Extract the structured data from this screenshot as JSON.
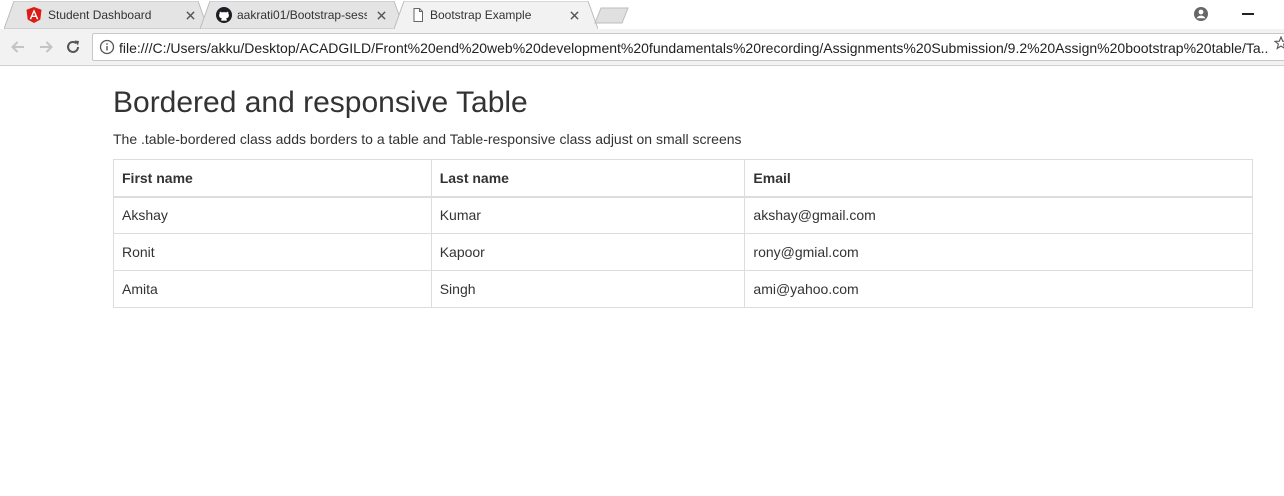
{
  "browser": {
    "tabs": [
      {
        "title": "Student Dashboard",
        "icon": "angular-icon",
        "active": false
      },
      {
        "title": "aakrati01/Bootstrap-sess",
        "icon": "github-icon",
        "active": false
      },
      {
        "title": "Bootstrap Example",
        "icon": "page-icon",
        "active": true
      }
    ],
    "url": "file:///C:/Users/akku/Desktop/ACADGILD/Front%20end%20web%20development%20fundamentals%20recording/Assignments%20Submission/9.2%20Assign%20bootstrap%20table/Ta..."
  },
  "page": {
    "heading": "Bordered and responsive Table",
    "description": "The .table-bordered class adds borders to a table and Table-responsive class adjust on small screens",
    "table": {
      "headers": [
        "First name",
        "Last name",
        "Email"
      ],
      "rows": [
        [
          "Akshay",
          "Kumar",
          "akshay@gmail.com"
        ],
        [
          "Ronit",
          "Kapoor",
          "rony@gmial.com"
        ],
        [
          "Amita",
          "Singh",
          "ami@yahoo.com"
        ]
      ]
    }
  },
  "colors": {
    "accent_angular": "#dd1b16",
    "table_border": "#dddddd",
    "text": "#333333"
  }
}
